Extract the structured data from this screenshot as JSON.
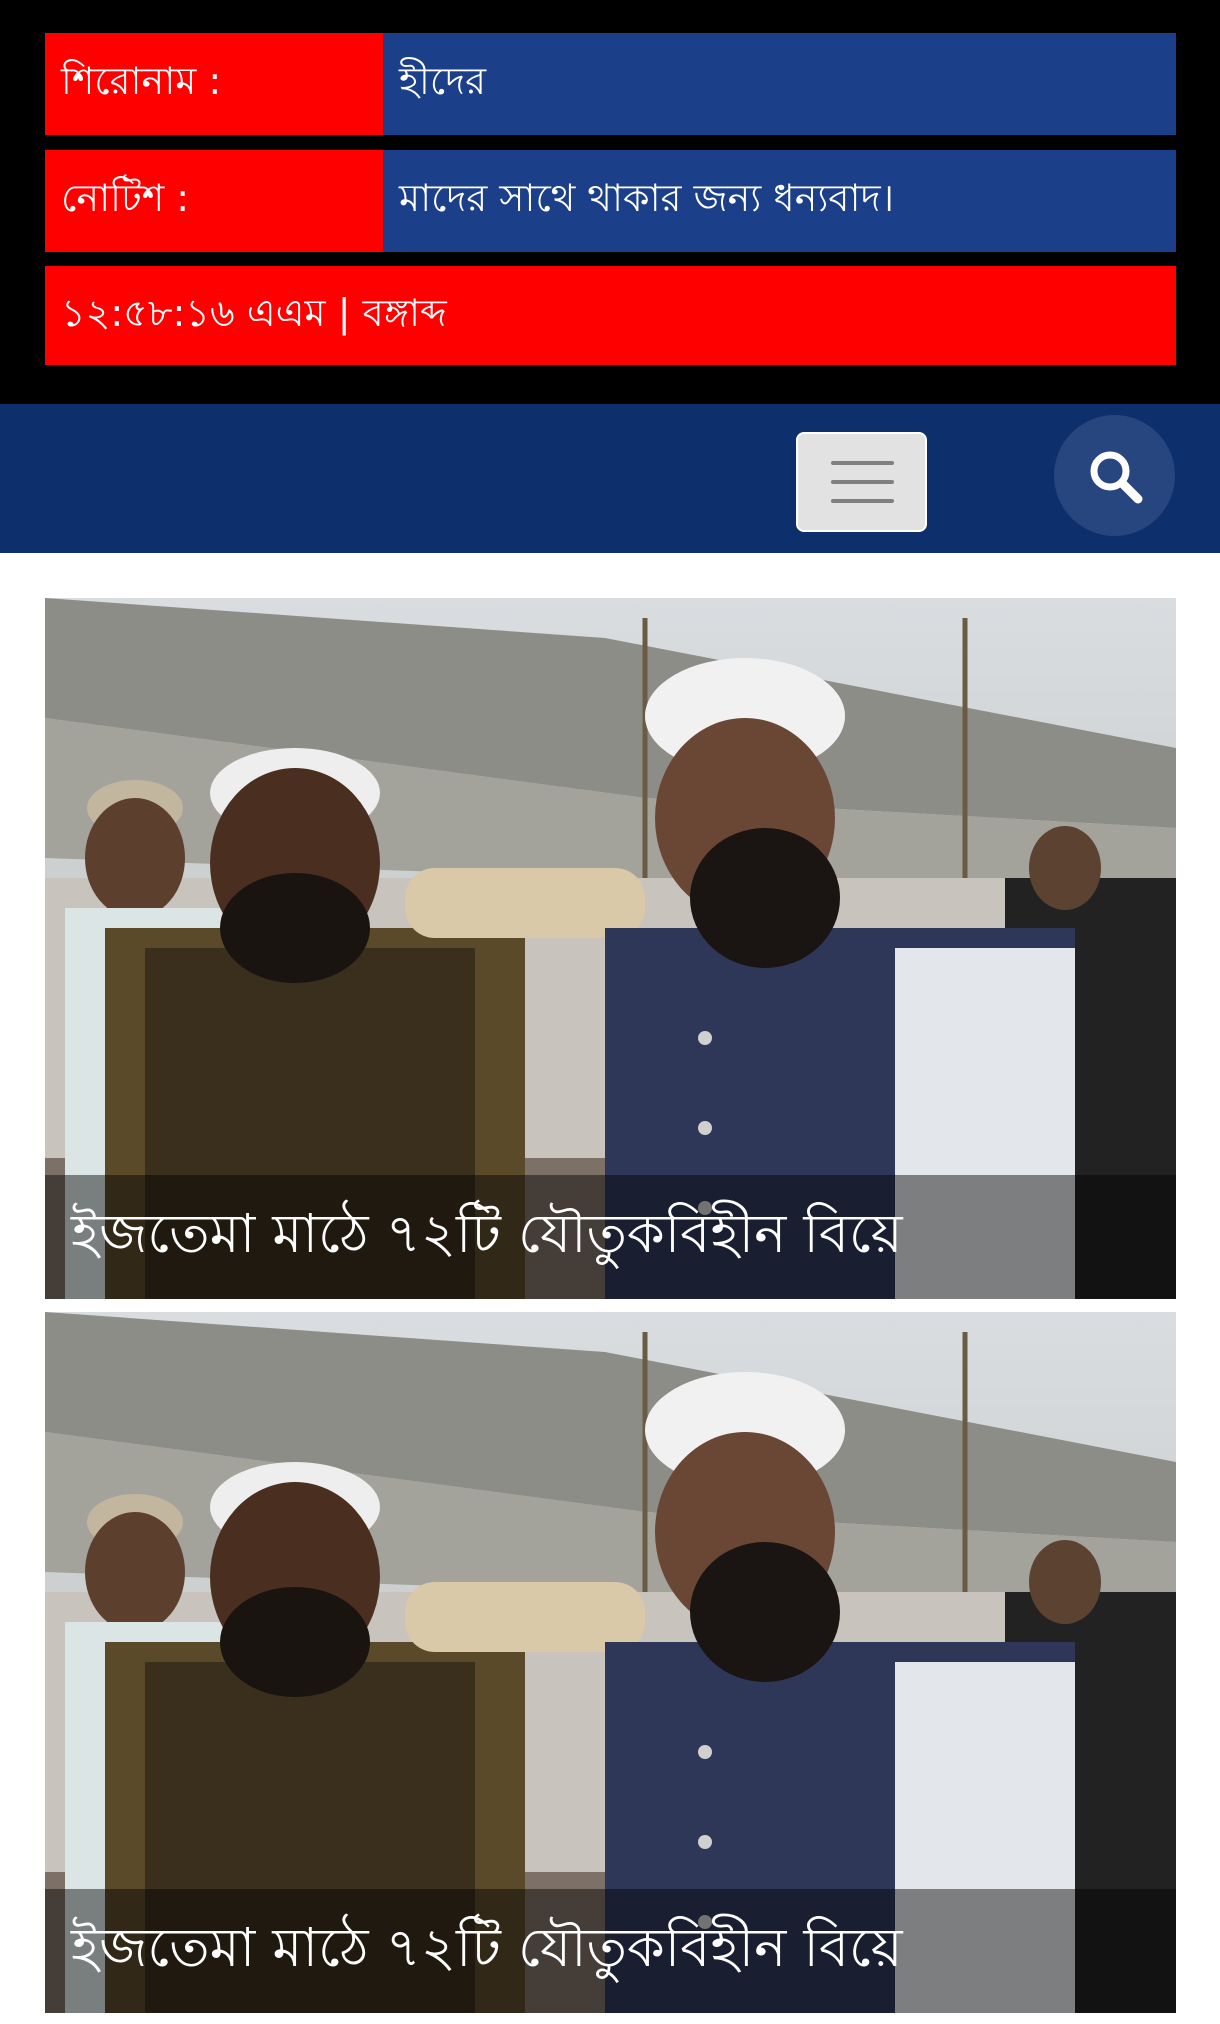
{
  "ticker": {
    "headline_label": "শিরোনাম :",
    "headline_text": "হীদের",
    "notice_label": "নোটিশ :",
    "notice_text": "মাদের সাথে থাকার জন্য ধন্যবাদ।",
    "clock_text": "১২:৫৮:১৬ এএম | বঙ্গাব্দ"
  },
  "nav": {
    "menu_icon": "hamburger-menu-icon",
    "search_icon": "search-icon"
  },
  "articles": [
    {
      "title": "ইজতেমা মাঠে ৭২টি যৌতুকবিহীন বিয়ে"
    },
    {
      "title": "ইজতেমা মাঠে ৭২টি যৌতুকবিহীন বিয়ে"
    }
  ],
  "colors": {
    "label_red": "#ff0000",
    "value_blue": "#1c3f8a",
    "nav_blue": "#0d2f6b",
    "top_black": "#000000"
  }
}
